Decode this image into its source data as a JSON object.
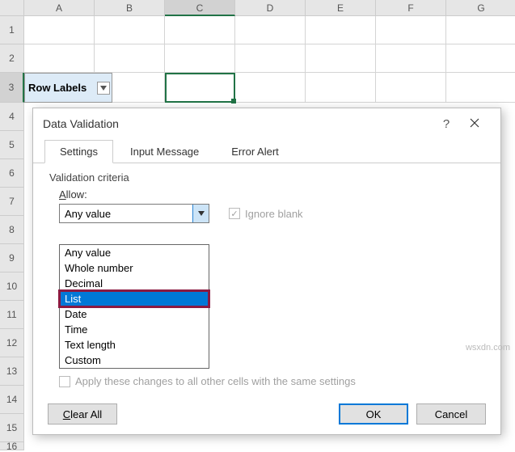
{
  "grid": {
    "columns": [
      "A",
      "B",
      "C",
      "D",
      "E",
      "F",
      "G"
    ],
    "rows": [
      "1",
      "2",
      "3",
      "4",
      "5",
      "6",
      "7",
      "8",
      "9",
      "10",
      "11",
      "12",
      "13",
      "14",
      "15",
      "16"
    ],
    "a3_label": "Row Labels",
    "active_col": "C",
    "active_row": "3"
  },
  "dialog": {
    "title": "Data Validation",
    "tabs": {
      "settings": "Settings",
      "input_message": "Input Message",
      "error_alert": "Error Alert"
    },
    "criteria_label": "Validation criteria",
    "allow_label": "Allow:",
    "allow_value": "Any value",
    "ignore_blank": "Ignore blank",
    "dropdown_options": {
      "any_value": "Any value",
      "whole_number": "Whole number",
      "decimal": "Decimal",
      "list": "List",
      "date": "Date",
      "time": "Time",
      "text_length": "Text length",
      "custom": "Custom"
    },
    "apply_label": "Apply these changes to all other cells with the same settings",
    "buttons": {
      "clear_all": "Clear All",
      "ok": "OK",
      "cancel": "Cancel"
    }
  },
  "watermark": "wsxdn.com"
}
